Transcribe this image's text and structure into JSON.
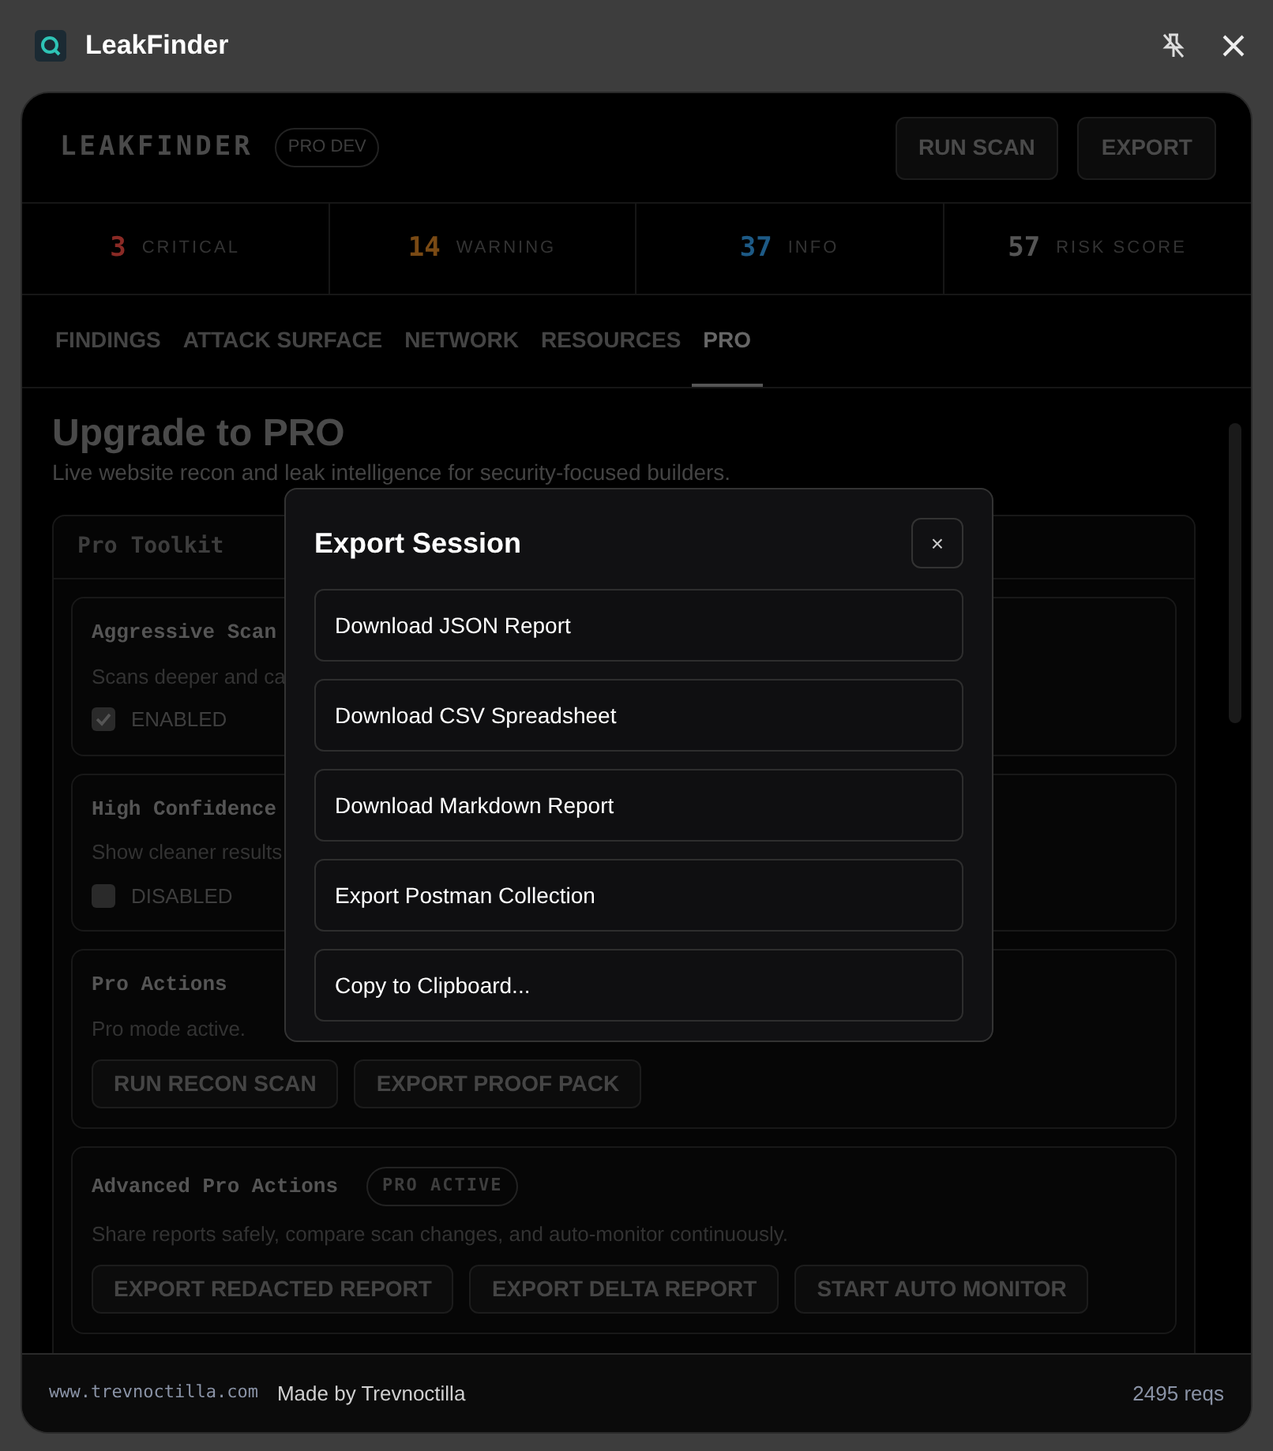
{
  "window": {
    "title": "LeakFinder"
  },
  "app": {
    "brand": "LEAKFINDER",
    "badge": "PRO DEV",
    "buttons": [
      "RUN SCAN",
      "EXPORT"
    ]
  },
  "stats": [
    {
      "value": "3",
      "label": "CRITICAL",
      "color": "#8a2a25"
    },
    {
      "value": "14",
      "label": "WARNING",
      "color": "#7a4a14"
    },
    {
      "value": "37",
      "label": "INFO",
      "color": "#1d5a86"
    },
    {
      "value": "57",
      "label": "RISK SCORE",
      "color": "#555555"
    }
  ],
  "tabs": [
    {
      "label": "FINDINGS",
      "selected": false
    },
    {
      "label": "ATTACK SURFACE",
      "selected": false
    },
    {
      "label": "NETWORK",
      "selected": false
    },
    {
      "label": "RESOURCES",
      "selected": false
    },
    {
      "label": "PRO",
      "selected": true
    }
  ],
  "page": {
    "title": "Upgrade to PRO",
    "subtitle": "Live website recon and leak intelligence for security-focused builders.",
    "toolkit": {
      "title": "Pro Toolkit",
      "sections": [
        {
          "kind": "toggle",
          "title": "Aggressive Scan",
          "description": "Scans deeper and ca",
          "checked": true,
          "state_label": "ENABLED"
        },
        {
          "kind": "toggle",
          "title": "High Confidence",
          "description": "Show cleaner results",
          "checked": false,
          "state_label": "DISABLED"
        },
        {
          "kind": "actions",
          "title": "Pro Actions",
          "description": "Pro mode active.",
          "buttons": [
            "RUN RECON SCAN",
            "EXPORT PROOF PACK"
          ]
        },
        {
          "kind": "actions",
          "title": "Advanced Pro Actions",
          "badge": "PRO ACTIVE",
          "description": "Share reports safely, compare scan changes, and auto-monitor continuously.",
          "buttons": [
            "EXPORT REDACTED REPORT",
            "EXPORT DELTA REPORT",
            "START AUTO MONITOR"
          ]
        }
      ]
    }
  },
  "modal": {
    "title": "Export Session",
    "close": "×",
    "options": [
      "Download JSON Report",
      "Download CSV Spreadsheet",
      "Download Markdown Report",
      "Export Postman Collection",
      "Copy to Clipboard..."
    ]
  },
  "footer": {
    "site": "www.trevnoctilla.com",
    "credit": "Made by Trevnoctilla",
    "requests": "2495 reqs"
  }
}
